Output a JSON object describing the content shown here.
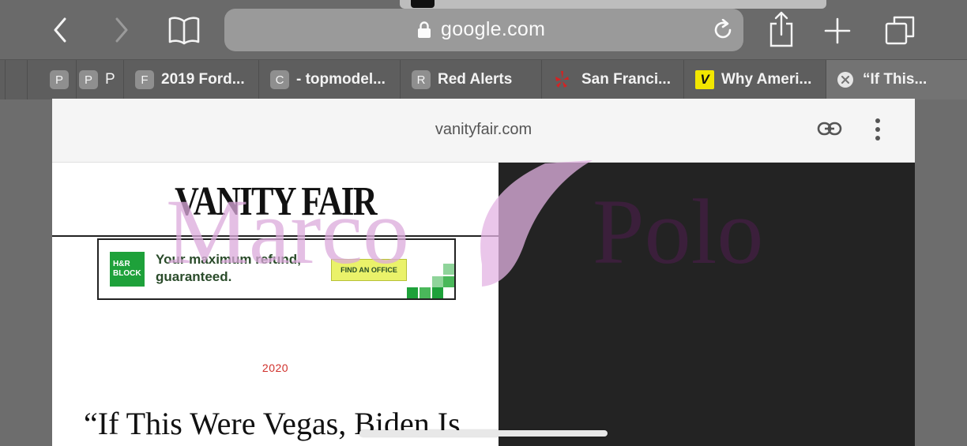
{
  "toolbar": {
    "url_host": "google.com",
    "icons": [
      "back-icon",
      "forward-icon",
      "bookmarks-icon",
      "lock-icon",
      "reload-icon",
      "share-icon",
      "new-tab-icon",
      "tabs-icon"
    ]
  },
  "tabs": [
    {
      "badge": "P",
      "label": ""
    },
    {
      "badge": "P",
      "label": "P"
    },
    {
      "badge": "F",
      "label": "2019 Ford..."
    },
    {
      "badge": "C",
      "label": "- topmodel..."
    },
    {
      "badge": "R",
      "label": "Red Alerts"
    },
    {
      "badge": "",
      "label": "San Franci..."
    },
    {
      "badge": "V",
      "label": "Why Ameri..."
    },
    {
      "badge": "",
      "label": "“If This..."
    }
  ],
  "page": {
    "site": "vanityfair.com",
    "logo": "VANITY FAIR",
    "ad": {
      "brand": "H&R BLOCK",
      "message": "Your maximum refund, guaranteed.",
      "cta": "FIND AN OFFICE"
    },
    "tag": "2020",
    "headline": "“If This Were Vegas, Biden Is"
  },
  "watermark": {
    "left": "Marco",
    "right": "Polo"
  },
  "colors": {
    "tag_red": "#d0302b",
    "ad_green": "#1ea13a",
    "watermark_pink": "#d9a6d9",
    "watermark_purple": "#3e1f3e"
  }
}
